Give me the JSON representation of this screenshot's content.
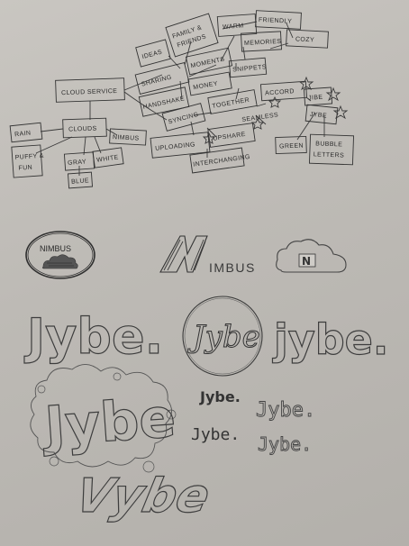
{
  "mindmap": {
    "nodes": [
      {
        "id": "cloud-service",
        "label": "CLOUD SERVICE"
      },
      {
        "id": "ideas",
        "label": "IDEAS"
      },
      {
        "id": "family-friends-1",
        "label": "FAMILY &"
      },
      {
        "id": "family-friends-2",
        "label": "FRIENDS"
      },
      {
        "id": "warm",
        "label": "WARM"
      },
      {
        "id": "friendly",
        "label": "FRIENDLY"
      },
      {
        "id": "memories",
        "label": "MEMORIES"
      },
      {
        "id": "cozy",
        "label": "COZY"
      },
      {
        "id": "sharing",
        "label": "SHARING"
      },
      {
        "id": "moments",
        "label": "MOMENTS"
      },
      {
        "id": "snippets",
        "label": "SNIPPETS"
      },
      {
        "id": "handshake",
        "label": "HANDSHAKE"
      },
      {
        "id": "money",
        "label": "MONEY"
      },
      {
        "id": "together",
        "label": "TOGETHER"
      },
      {
        "id": "accord",
        "label": "ACCORD"
      },
      {
        "id": "jibe",
        "label": "JIBE"
      },
      {
        "id": "jybe",
        "label": "JYBE"
      },
      {
        "id": "syncing",
        "label": "SYNCING"
      },
      {
        "id": "seamless",
        "label": "SEAMLESS"
      },
      {
        "id": "uploading",
        "label": "UPLOADING"
      },
      {
        "id": "upshare",
        "label": "UPSHARE"
      },
      {
        "id": "interchanging",
        "label": "INTERCHANGING"
      },
      {
        "id": "green",
        "label": "GREEN"
      },
      {
        "id": "bubble-1",
        "label": "BUBBLE"
      },
      {
        "id": "bubble-2",
        "label": "LETTERS"
      },
      {
        "id": "rain",
        "label": "RAIN"
      },
      {
        "id": "clouds",
        "label": "CLOUDS"
      },
      {
        "id": "nimbus",
        "label": "NIMBUS"
      },
      {
        "id": "puffy-1",
        "label": "PUFFY &"
      },
      {
        "id": "puffy-2",
        "label": "FUN"
      },
      {
        "id": "gray",
        "label": "GRAY"
      },
      {
        "id": "white",
        "label": "WHITE"
      },
      {
        "id": "blue",
        "label": "BLUE"
      }
    ]
  },
  "logos": {
    "nimbus_badge": "NIMBUS",
    "nimbus_n": "N",
    "nimbus_word": "IMBUS",
    "cloud_n": "N",
    "jybe_outline": "Jybe.",
    "jybe_script": "Jybe",
    "jybe_bubble_right": "jybe.",
    "jybe_graffiti": "Jybe",
    "jybe_small_1": "Jybe.",
    "jybe_pixel_1": "Jybe.",
    "jybe_small_2": "Jybe.",
    "jybe_pixel_2": "Jybe.",
    "jybe_italic": "Vybe"
  },
  "colors": {
    "paper": "#c4c1bc",
    "ink": "#333333",
    "background": "#8e8a85"
  }
}
